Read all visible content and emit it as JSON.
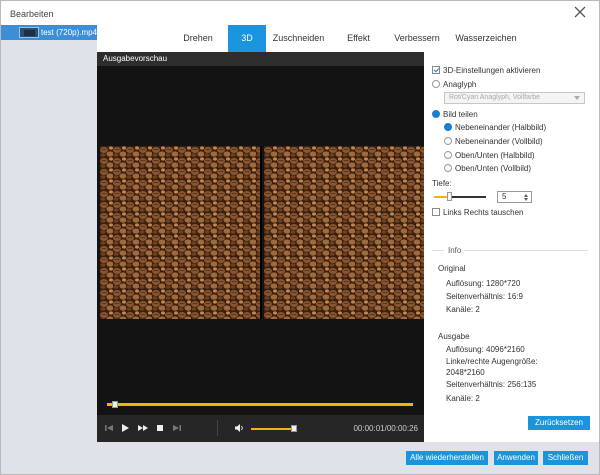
{
  "window": {
    "title": "Bearbeiten"
  },
  "sidebar": {
    "files": [
      {
        "name": "test (720p).mp4"
      }
    ]
  },
  "tabs": [
    {
      "label": "Drehen",
      "active": false
    },
    {
      "label": "3D",
      "active": true
    },
    {
      "label": "Zuschneiden",
      "active": false
    },
    {
      "label": "Effekt",
      "active": false
    },
    {
      "label": "Verbessern",
      "active": false
    },
    {
      "label": "Wasserzeichen",
      "active": false
    }
  ],
  "preview": {
    "header": "Ausgabevorschau",
    "playback_progress": 0.03,
    "volume": 0.92,
    "time": "00:00:01/00:00:26"
  },
  "panel": {
    "enable_3d": {
      "label": "3D-Einstellungen aktivieren",
      "checked": true
    },
    "anaglyph": {
      "label": "Anaglyph",
      "selected": false,
      "dropdown_value": "Rot/Cyan Anaglyph, Vollfarbe"
    },
    "split": {
      "label": "Bild teilen",
      "selected": true,
      "options": [
        {
          "label": "Nebeneinander (Halbbild)",
          "selected": true
        },
        {
          "label": "Nebeneinander (Vollbild)",
          "selected": false
        },
        {
          "label": "Oben/Unten (Halbbild)",
          "selected": false
        },
        {
          "label": "Oben/Unten (Vollbild)",
          "selected": false
        }
      ]
    },
    "depth": {
      "label": "Tiefe:",
      "value": "5"
    },
    "swap": {
      "label": "Links Rechts tauschen",
      "checked": false
    },
    "info": {
      "title": "Info",
      "original_title": "Original",
      "original": [
        "Auflösung: 1280*720",
        "Seitenverhältnis: 16:9",
        "Kanäle: 2"
      ],
      "output_title": "Ausgabe",
      "output": [
        "Auflösung: 4096*2160",
        "Linke/rechte Augengröße:",
        "2048*2160",
        "Seitenverhältnis: 256:135",
        "Kanäle: 2"
      ]
    },
    "reset_label": "Zurücksetzen"
  },
  "footer": {
    "restore_all": "Alle wiederherstellen",
    "apply": "Anwenden",
    "close": "Schließen"
  },
  "colors": {
    "accent": "#1a94dc",
    "timeline": "#f4b400",
    "sidebar_bg": "#dfe2e8",
    "selected_file": "#3c8fd6"
  }
}
